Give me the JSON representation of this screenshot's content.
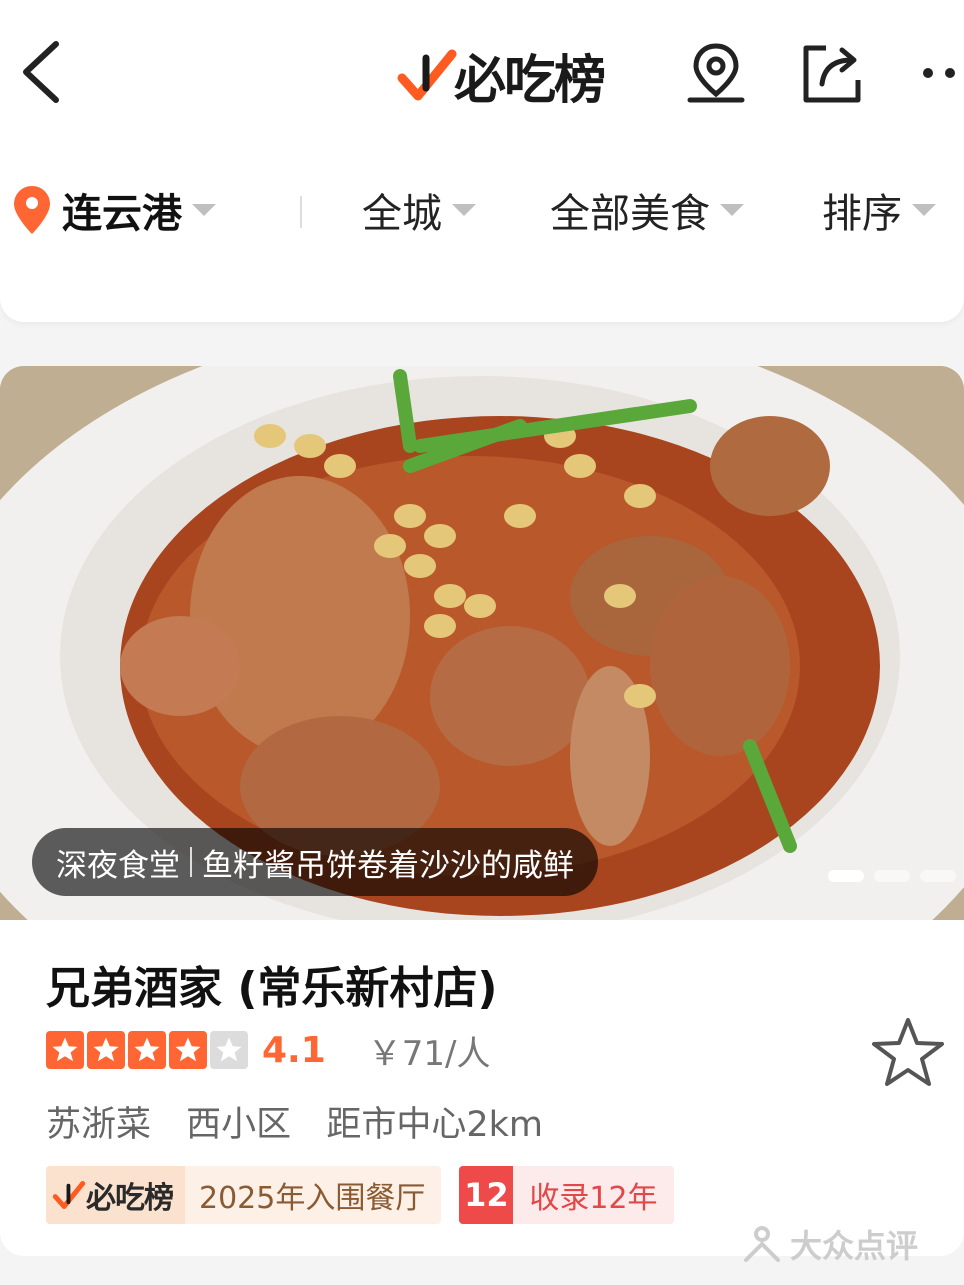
{
  "header": {
    "brand": "必吃榜",
    "icons": [
      "back-icon",
      "map-pin-icon",
      "share-icon",
      "more-icon"
    ]
  },
  "filters": {
    "city": "连云港",
    "area": "全城",
    "category": "全部美食",
    "sort": "排序"
  },
  "card": {
    "caption_tag": "深夜食堂",
    "caption_text": "鱼籽酱吊饼卷着沙沙的咸鲜",
    "carousel_total": 3,
    "carousel_active": 1,
    "name": "兄弟酒家 (常乐新村店)",
    "star_count": 4,
    "star_max": 5,
    "score": "4.1",
    "price": "￥71/人",
    "tags": [
      "苏浙菜",
      "西小区",
      "距市中心2km"
    ],
    "badge_brand": "必吃榜",
    "badge_award": "2025年入围餐厅",
    "badge_years_num": "12",
    "badge_years_text": "收录12年"
  },
  "watermark": "大众点评",
  "colors": {
    "accent": "#ff6633",
    "badge_red": "#ee4a4a",
    "badge_brown": "#8a5a32"
  }
}
